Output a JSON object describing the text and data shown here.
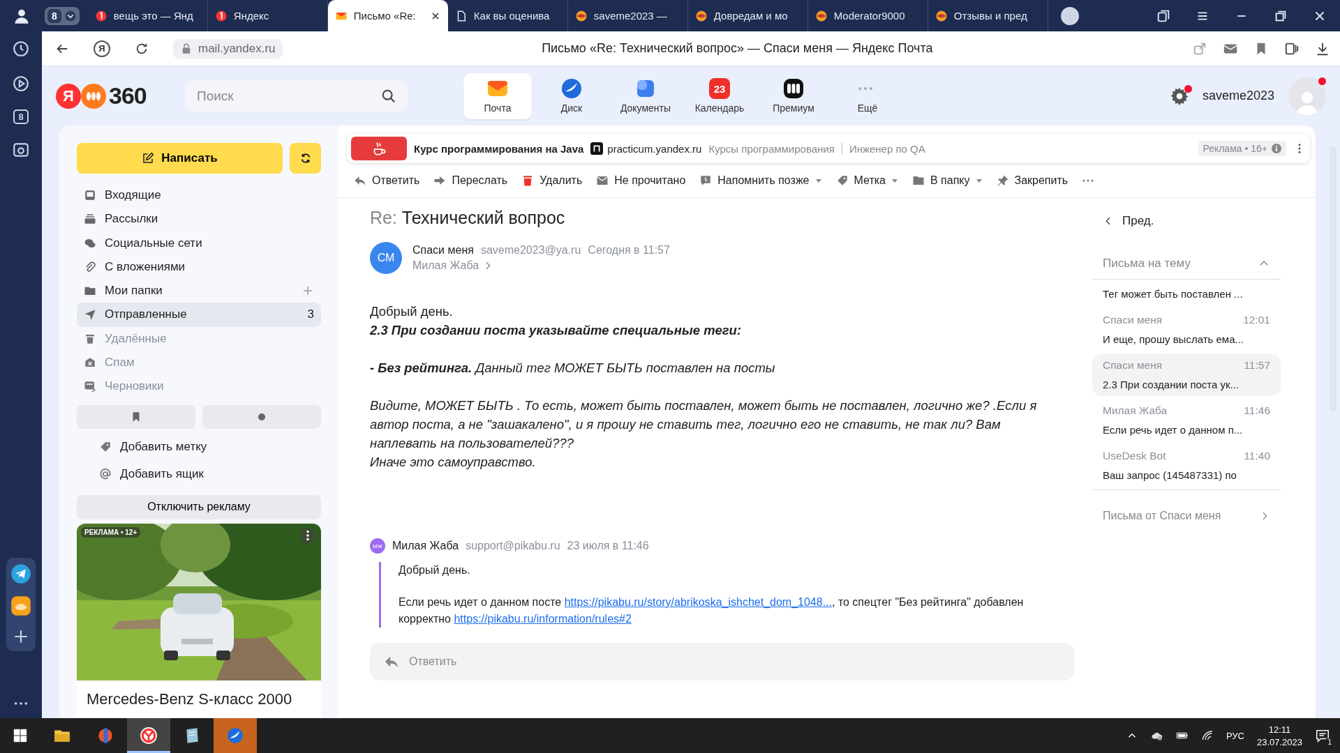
{
  "browser": {
    "tab_count": "8",
    "home_button": "Я",
    "tabs": [
      {
        "title": "вещь это — Янд",
        "kind": "yandex",
        "selected": false
      },
      {
        "title": "Яндекс",
        "kind": "yandex",
        "selected": false
      },
      {
        "title": "Письмо «Re:",
        "kind": "mail",
        "selected": true
      },
      {
        "title": "Как вы оценива",
        "kind": "page",
        "selected": false
      },
      {
        "title": "saveme2023 —",
        "kind": "pikabu",
        "selected": false
      },
      {
        "title": "Довредам и мо",
        "kind": "pikabu",
        "selected": false
      },
      {
        "title": "Moderator9000",
        "kind": "pikabu",
        "selected": false
      },
      {
        "title": "Отзывы и пред",
        "kind": "pikabu",
        "selected": false
      }
    ],
    "address": "mail.yandex.ru",
    "page_title": "Письмо «Re: Технический вопрос» — Спаси меня — Яндекс Почта",
    "rail_badge": "8"
  },
  "header": {
    "logo": {
      "mark": "Я",
      "text": "360"
    },
    "search": {
      "placeholder": "Поиск"
    },
    "services": [
      {
        "label": "Почта",
        "kind": "mail",
        "selected": true
      },
      {
        "label": "Диск",
        "kind": "disk",
        "selected": false
      },
      {
        "label": "Документы",
        "kind": "docs",
        "selected": false
      },
      {
        "label": "Календарь",
        "kind": "calendar",
        "badge": "23",
        "selected": false
      },
      {
        "label": "Премиум",
        "kind": "premium",
        "selected": false
      },
      {
        "label": "Ещё",
        "kind": "more",
        "selected": false
      }
    ],
    "settings_alert": true,
    "username": "saveme2023",
    "avatar_alert": true
  },
  "sidebar": {
    "compose": "Написать",
    "folders": [
      {
        "label": "Входящие",
        "kind": "inbox",
        "selected": false,
        "muted": false
      },
      {
        "label": "Рассылки",
        "kind": "newsletters",
        "selected": false,
        "muted": false
      },
      {
        "label": "Социальные сети",
        "kind": "social",
        "selected": false,
        "muted": false
      },
      {
        "label": "С вложениями",
        "kind": "attachments",
        "selected": false,
        "muted": false
      },
      {
        "label": "Мои папки",
        "kind": "folders",
        "selected": false,
        "muted": false,
        "addable": true
      },
      {
        "label": "Отправленные",
        "kind": "sent",
        "count": "3",
        "selected": true,
        "muted": false
      },
      {
        "label": "Удалённые",
        "kind": "trash",
        "selected": false,
        "muted": true
      },
      {
        "label": "Спам",
        "kind": "spam",
        "selected": false,
        "muted": true
      },
      {
        "label": "Черновики",
        "kind": "drafts",
        "selected": false,
        "muted": true
      }
    ],
    "links": [
      {
        "label": "Добавить метку",
        "kind": "tag"
      },
      {
        "label": "Добавить ящик",
        "kind": "at"
      }
    ],
    "disable_ads": "Отключить рекламу",
    "ad": {
      "label": "РЕКЛАМА • 12+",
      "title": "Mercedes-Benz S-класс 2000"
    }
  },
  "ad_banner": {
    "title": "Курс программирования на Java",
    "site": "practicum.yandex.ru",
    "tags": [
      "Курсы программирования",
      "Инженер по QA"
    ],
    "label": "Реклама • 16+"
  },
  "toolbar": [
    {
      "label": "Ответить",
      "kind": "reply",
      "dropdown": false
    },
    {
      "label": "Переслать",
      "kind": "forward",
      "dropdown": false
    },
    {
      "label": "Удалить",
      "kind": "delete",
      "dropdown": false
    },
    {
      "label": "Не прочитано",
      "kind": "unread",
      "dropdown": false
    },
    {
      "label": "Напомнить позже",
      "kind": "remind",
      "dropdown": true
    },
    {
      "label": "Метка",
      "kind": "tag",
      "dropdown": true
    },
    {
      "label": "В папку",
      "kind": "folder",
      "dropdown": true
    },
    {
      "label": "Закрепить",
      "kind": "pin",
      "dropdown": false
    },
    {
      "kind": "more",
      "dropdown": false
    }
  ],
  "message": {
    "subject_prefix": "Re:",
    "subject": "Технический вопрос",
    "avatar": "СМ",
    "from": "Спаси меня",
    "email": "saveme2023@ya.ru",
    "date": "Сегодня в 11:57",
    "to": "Милая Жаба",
    "body": [
      {
        "lines": [
          {
            "kind": "plain",
            "text": "Добрый день."
          },
          {
            "kind": "bolditalic",
            "text": "2.3 При создании поста указывайте специальные теги:"
          }
        ]
      },
      {
        "lines": [
          {
            "kind": "italic",
            "text": "**- Без рейтинга.** Данный тег МОЖЕТ БЫТЬ поставлен на посты"
          }
        ]
      },
      {
        "lines": [
          {
            "kind": "italic",
            "text": "Видите, МОЖЕТ БЫТЬ . То есть, может быть поставлен, может быть не поставлен, логично же? .Если я автор поста, а не \"зашакалено\", и я  прошу не ставить тег, логично его не ставить, не  так ли?  Вам наплевать на пользователей???"
          },
          {
            "kind": "italic",
            "text": "Иначе это самоуправство."
          }
        ]
      }
    ]
  },
  "quoted": {
    "avatar": "МЖ",
    "from": "Милая Жаба",
    "email": "support@pikabu.ru",
    "date": "23 июля в 11:46",
    "paragraphs": [
      [
        {
          "text": "Добрый день."
        }
      ],
      [
        {
          "text": "Если речь идет о данном посте "
        },
        {
          "text": "https://pikabu.ru/story/abrikoska_ishchet_dom_1048...",
          "kind": "link"
        },
        {
          "text": ", то спецтег \"Без рейтинга\" добавлен корректно "
        },
        {
          "text": "https://pikabu.ru/information/rules#2",
          "kind": "link"
        }
      ]
    ]
  },
  "reply_box": {
    "placeholder": "Ответить"
  },
  "thread_panel": {
    "prev": "Пред.",
    "title": "Письма на тему",
    "expanded": true,
    "items": [
      {
        "snippet": "Тег может быть поставлен ...",
        "selected": false
      },
      {
        "from": "Спаси меня",
        "time": "12:01",
        "snippet": "И еще, прошу выслать ема...",
        "selected": false
      },
      {
        "from": "Спаси меня",
        "time": "11:57",
        "snippet": "2.3 При создании поста ук...",
        "selected": true
      },
      {
        "from": "Милая Жаба",
        "time": "11:46",
        "snippet": "Если речь идет о данном п...",
        "selected": false
      },
      {
        "from": "UseDesk Bot",
        "time": "11:40",
        "snippet": "Ваш запрос (145487331) по",
        "selected": false
      }
    ],
    "from_sender": "Письма от Спаси меня"
  },
  "taskbar": {
    "apps": [
      {
        "kind": "explorer",
        "selected": false,
        "flashing": false
      },
      {
        "kind": "app",
        "selected": false,
        "flashing": false
      },
      {
        "kind": "browser",
        "selected": true,
        "flashing": false
      },
      {
        "kind": "notes",
        "selected": false,
        "flashing": false
      },
      {
        "kind": "disk",
        "selected": false,
        "flashing": true
      }
    ],
    "lang": "РУС",
    "time": "12:11",
    "date": "23.07.2023",
    "notifications": "1"
  }
}
